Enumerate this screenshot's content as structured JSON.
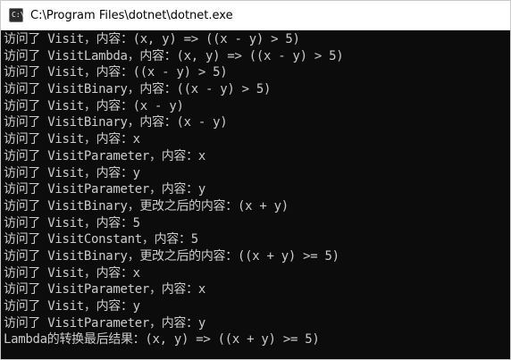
{
  "window": {
    "title": "C:\\Program Files\\dotnet\\dotnet.exe",
    "icon": "console-app-icon",
    "icon_text": "C:\\"
  },
  "console": {
    "lines": [
      "访问了 Visit，内容：(x, y) => ((x - y) > 5)",
      "访问了 VisitLambda，内容：(x, y) => ((x - y) > 5)",
      "访问了 Visit，内容：((x - y) > 5)",
      "访问了 VisitBinary，内容：((x - y) > 5)",
      "访问了 Visit，内容：(x - y)",
      "访问了 VisitBinary，内容：(x - y)",
      "访问了 Visit，内容：x",
      "访问了 VisitParameter，内容：x",
      "访问了 Visit，内容：y",
      "访问了 VisitParameter，内容：y",
      "访问了 VisitBinary，更改之后的内容：(x + y)",
      "访问了 Visit，内容：5",
      "访问了 VisitConstant，内容：5",
      "访问了 VisitBinary，更改之后的内容：((x + y) >= 5)",
      "访问了 Visit，内容：x",
      "访问了 VisitParameter，内容：x",
      "访问了 Visit，内容：y",
      "访问了 VisitParameter，内容：y",
      "Lambda的转换最后结果：(x, y) => ((x + y) >= 5)"
    ]
  },
  "colors": {
    "console_background": "#0c0c0c",
    "console_text": "#cccccc",
    "titlebar_background": "#ffffff"
  }
}
